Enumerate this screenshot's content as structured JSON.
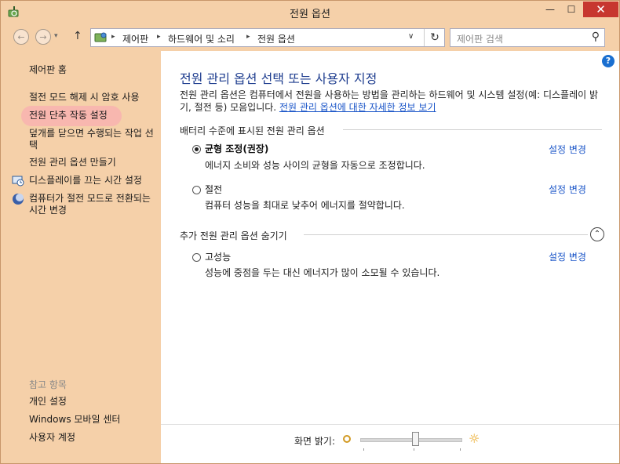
{
  "window": {
    "title": "전원 옵션",
    "min": "—",
    "max": "☐",
    "close": "✕"
  },
  "nav": {
    "back": "←",
    "forward": "→",
    "history": "▾",
    "up": "↑",
    "crumbs": [
      "제어판",
      "하드웨어 및 소리",
      "전원 옵션"
    ],
    "crumb_sep": "▸",
    "dropdown": "∨",
    "refresh": "↻",
    "search_placeholder": "제어판 검색",
    "search_icon": "⚲"
  },
  "sidebar": {
    "home": "제어판 홈",
    "links": [
      "절전 모드 해제 시 암호 사용",
      "전원 단추 작동 설정",
      "덮개를 닫으면 수행되는 작업 선택",
      "전원 관리 옵션 만들기",
      "디스플레이를 끄는 시간 설정",
      "컴퓨터가 절전 모드로 전환되는 시간 변경"
    ],
    "see_also_title": "참고 항목",
    "see_also": [
      "개인 설정",
      "Windows 모바일 센터",
      "사용자 계정"
    ]
  },
  "main": {
    "help": "?",
    "title": "전원 관리 옵션 선택 또는 사용자 지정",
    "desc": "전원 관리 옵션은 컴퓨터에서 전원을 사용하는 방법을 관리하는 하드웨어 및 시스템 설정(예: 디스플레이 밝기, 절전 등) 모음입니다.",
    "desc_link": "전원 관리 옵션에 대한 자세한 정보 보기",
    "section1": "배터리 수준에 표시된 전원 관리 옵션",
    "section2": "추가 전원 관리 옵션 숨기기",
    "collapse": "⌃",
    "plans": [
      {
        "name": "균형 조정(권장)",
        "desc": "에너지 소비와 성능 사이의 균형을 자동으로 조정합니다.",
        "change": "설정 변경",
        "selected": true
      },
      {
        "name": "절전",
        "desc": "컴퓨터 성능을 최대로 낮추어 에너지를 절약합니다.",
        "change": "설정 변경",
        "selected": false
      },
      {
        "name": "고성능",
        "desc": "성능에 중점을 두는 대신 에너지가 많이 소모될 수 있습니다.",
        "change": "설정 변경",
        "selected": false
      }
    ],
    "brightness_label": "화면 밝기:",
    "brightness_level": 0.55,
    "sun_icon": "☼"
  },
  "colors": {
    "accent": "#1a55c8",
    "title": "#1e3d8f",
    "frame": "#f5d0a9",
    "close": "#c7372f"
  }
}
